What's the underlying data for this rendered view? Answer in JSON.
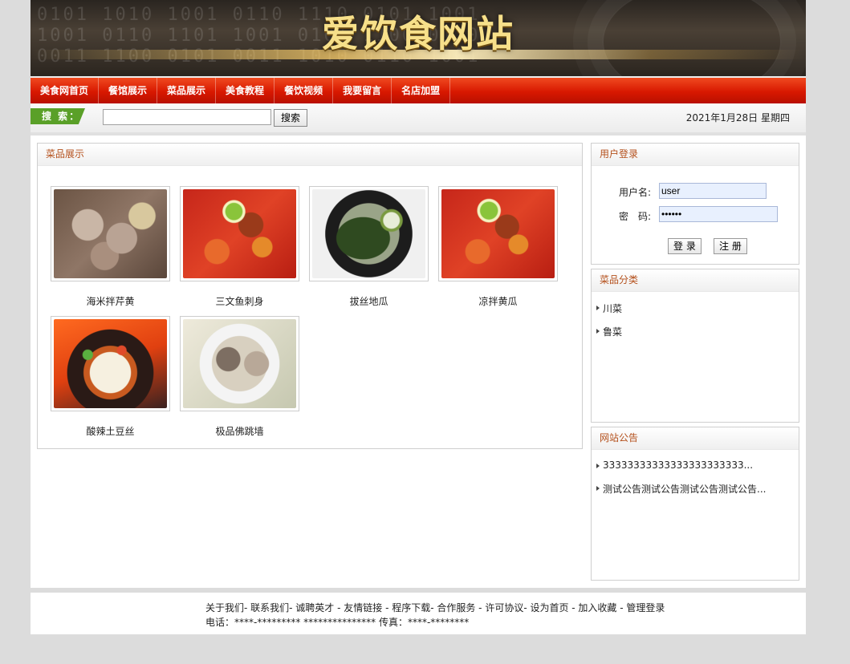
{
  "banner": {
    "title": "爱饮食网站"
  },
  "nav": [
    "美食网首页",
    "餐馆展示",
    "菜品展示",
    "美食教程",
    "餐饮视频",
    "我要留言",
    "名店加盟"
  ],
  "search": {
    "label": "搜 索：",
    "value": "",
    "button": "搜索"
  },
  "date": "2021年1月28日 星期四",
  "dishes": {
    "title": "菜品展示",
    "items": [
      {
        "name": "海米拌芹黄",
        "image": "braised-meat-dish"
      },
      {
        "name": "三文鱼刺身",
        "image": "red-chili-stew"
      },
      {
        "name": "拔丝地瓜",
        "image": "seaweed-soup"
      },
      {
        "name": "凉拌黄瓜",
        "image": "red-chili-stew"
      },
      {
        "name": "酸辣土豆丝",
        "image": "claypot-tofu"
      },
      {
        "name": "极品佛跳墙",
        "image": "meat-soup-bowl"
      }
    ]
  },
  "login": {
    "title": "用户登录",
    "username_label": "用户名:",
    "username_value": "user",
    "password_label": "密　码:",
    "password_value": "••••••",
    "login_button": "登 录",
    "register_button": "注 册"
  },
  "categories": {
    "title": "菜品分类",
    "items": [
      "川菜",
      "鲁菜"
    ]
  },
  "notices": {
    "title": "网站公告",
    "items": [
      "33333333333333333333333...",
      "测试公告测试公告测试公告测试公告..."
    ]
  },
  "footer": {
    "links": "关于我们- 联系我们- 诚聘英才 - 友情链接 - 程序下载- 合作服务 - 许可协议- 设为首页 - 加入收藏 - 管理登录",
    "contact": "电话：****-********* *************** 传真：****-********"
  },
  "colors": {
    "nav_red": "#d81800",
    "header_text": "#b4501c",
    "search_tag_green": "#5aa028",
    "banner_gold": "#f7e08a"
  }
}
